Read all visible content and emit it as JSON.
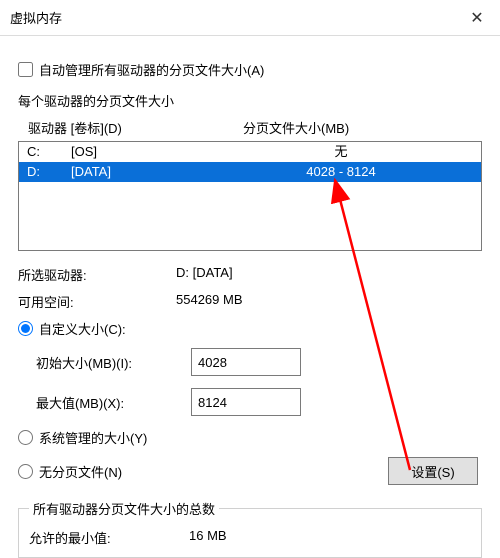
{
  "window": {
    "title": "虚拟内存"
  },
  "auto_manage": {
    "label": "自动管理所有驱动器的分页文件大小(A)",
    "checked": false
  },
  "per_drive_label": "每个驱动器的分页文件大小",
  "headers": {
    "drive": "驱动器 [卷标](D)",
    "size": "分页文件大小(MB)"
  },
  "drives": [
    {
      "letter": "C:",
      "label": "[OS]",
      "size": "无",
      "selected": false
    },
    {
      "letter": "D:",
      "label": "[DATA]",
      "size": "4028 - 8124",
      "selected": true
    }
  ],
  "selected_drive": {
    "label": "所选驱动器:",
    "value": "D:  [DATA]"
  },
  "free_space": {
    "label": "可用空间:",
    "value": "554269 MB"
  },
  "custom_size": {
    "label": "自定义大小(C):",
    "selected": true
  },
  "initial_size": {
    "label": "初始大小(MB)(I):",
    "value": "4028"
  },
  "max_size": {
    "label": "最大值(MB)(X):",
    "value": "8124"
  },
  "system_managed": {
    "label": "系统管理的大小(Y)",
    "selected": false
  },
  "no_paging": {
    "label": "无分页文件(N)",
    "selected": false
  },
  "set_button": "设置(S)",
  "totals": {
    "legend": "所有驱动器分页文件大小的总数",
    "min_allowed": {
      "label": "允许的最小值:",
      "value": "16 MB"
    }
  }
}
